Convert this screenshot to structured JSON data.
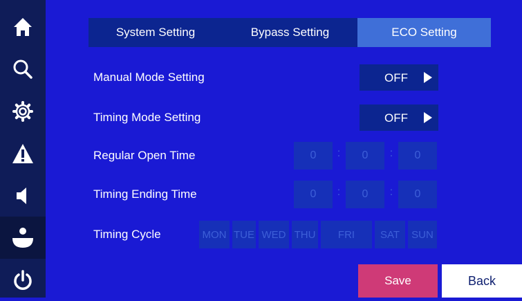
{
  "sidebar": {
    "items": [
      {
        "icon": "home-icon"
      },
      {
        "icon": "search-icon"
      },
      {
        "icon": "gear-icon"
      },
      {
        "icon": "warning-icon"
      },
      {
        "icon": "speaker-icon"
      },
      {
        "icon": "user-icon",
        "active": true
      },
      {
        "icon": "power-icon"
      }
    ]
  },
  "tabs": [
    {
      "label": "System Setting"
    },
    {
      "label": "Bypass Setting"
    },
    {
      "label": "ECO Setting",
      "selected": true
    }
  ],
  "manual_mode": {
    "label": "Manual Mode Setting",
    "value": "OFF"
  },
  "timing_mode": {
    "label": "Timing Mode Setting",
    "value": "OFF"
  },
  "open_time": {
    "label": "Regular Open Time",
    "h": "0",
    "m": "0",
    "s": "0"
  },
  "ending_time": {
    "label": "Timing Ending Time",
    "h": "0",
    "m": "0",
    "s": "0"
  },
  "separator": ":",
  "cycle": {
    "label": "Timing Cycle",
    "days": [
      "MON",
      "TUE",
      "WED",
      "THU",
      "FRI",
      "SAT",
      "SUN"
    ]
  },
  "actions": {
    "save": "Save",
    "back": "Back"
  },
  "colors": {
    "background": "#1a1ad4",
    "sidebar": "#0f1c58",
    "tab_bar": "#0c2590",
    "tab_selected": "#3f6fd8",
    "save": "#cf3a77",
    "back": "#ffffff"
  }
}
